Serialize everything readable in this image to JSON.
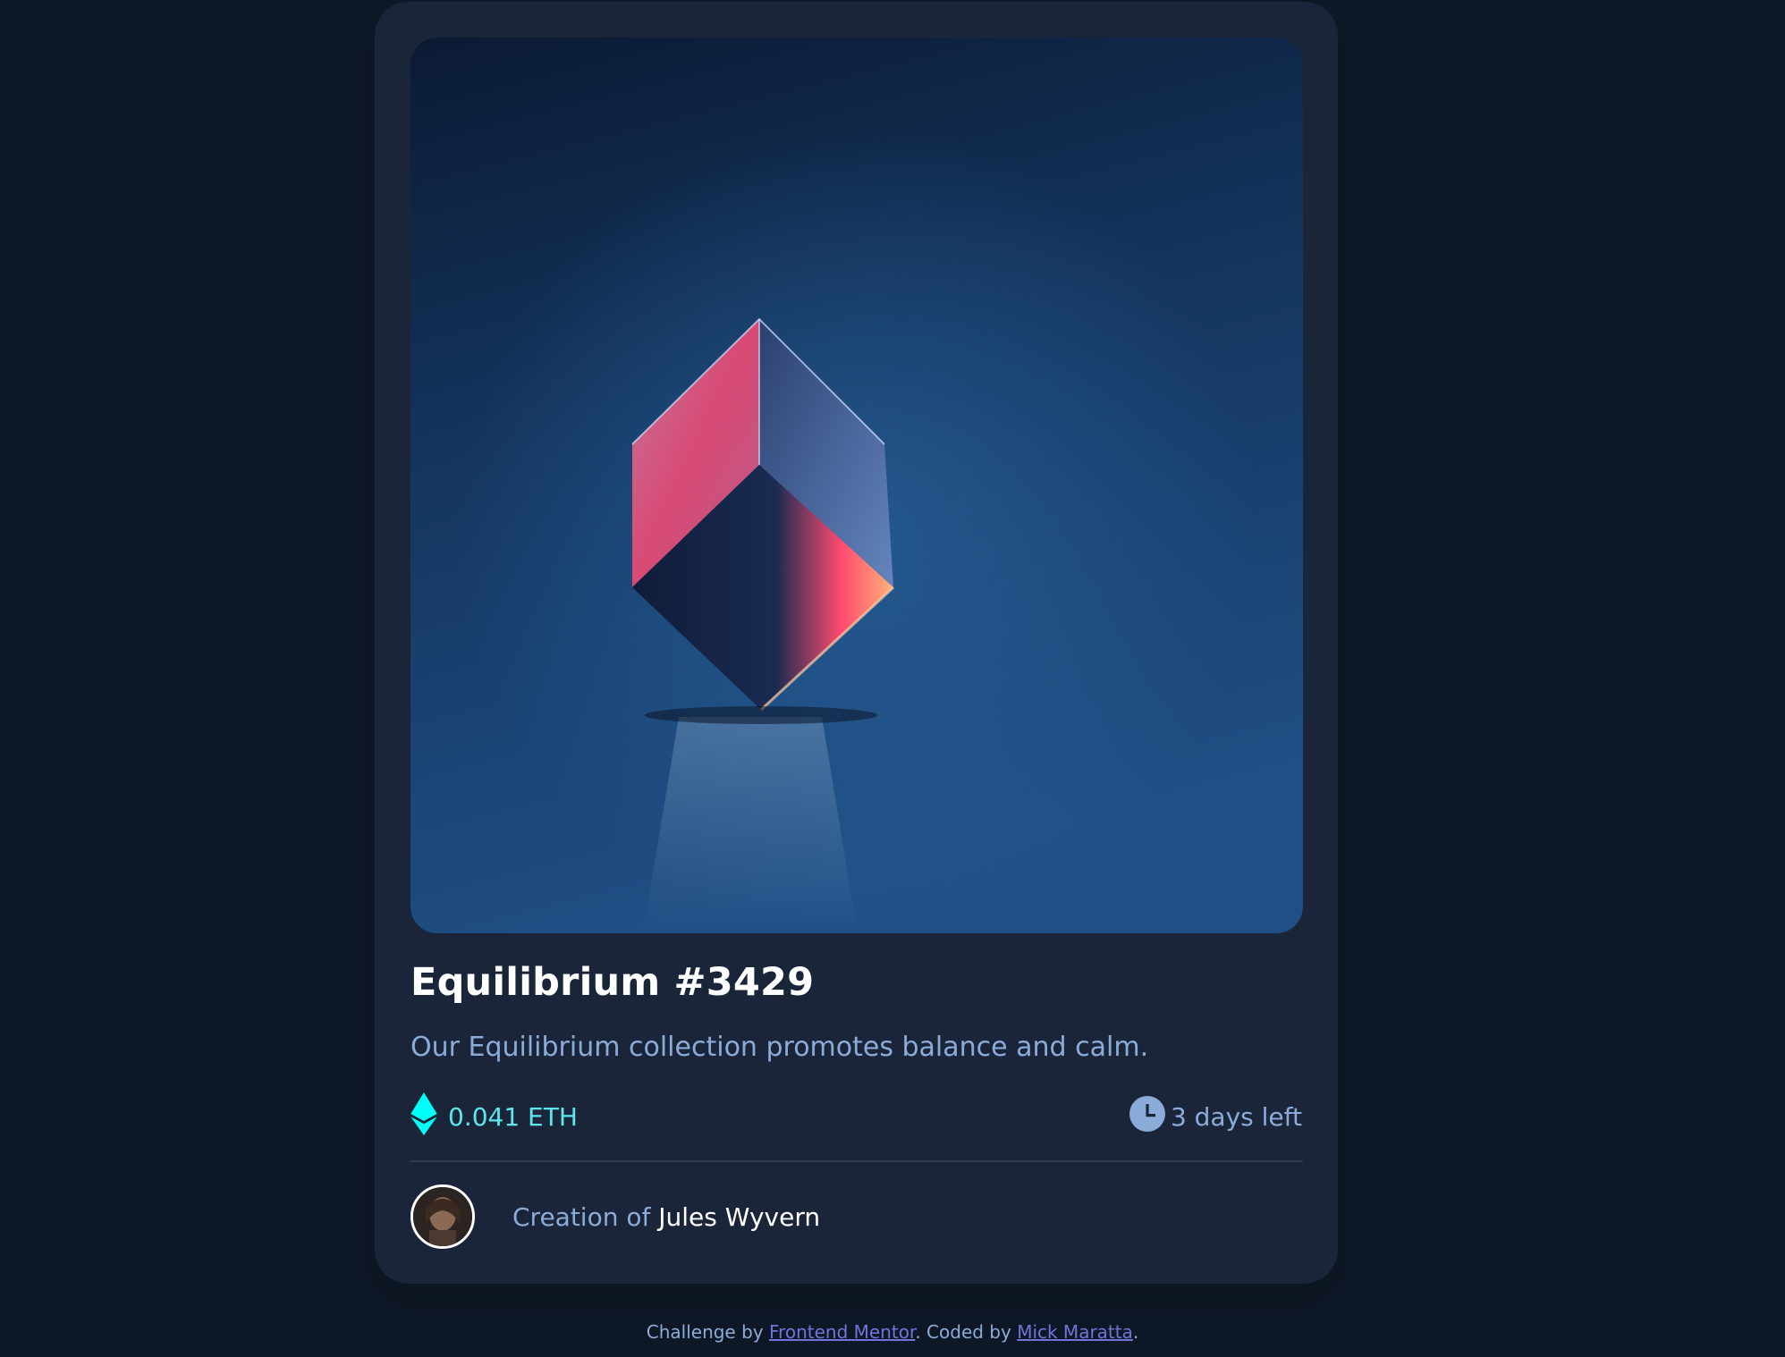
{
  "card": {
    "image_alt": "Equilibrium cube",
    "title": "Equilibrium #3429",
    "description": "Our Equilibrium collection promotes balance and calm.",
    "price": "0.041 ETH",
    "time_left": "3 days left",
    "creation_prefix": "Creation of ",
    "creator_name": "Jules Wyvern"
  },
  "footer": {
    "prefix": "Challenge by ",
    "link1": "Frontend Mentor",
    "middle": ". Coded by ",
    "link2": "Mick Maratta",
    "suffix": "."
  },
  "colors": {
    "page_bg": "#0f1827",
    "card_bg": "#1b2539",
    "accent_cyan": "#00fff8",
    "soft_blue": "#8bacd9",
    "white": "#ffffff"
  },
  "icons": {
    "price": "ethereum-icon",
    "time": "clock-icon"
  }
}
